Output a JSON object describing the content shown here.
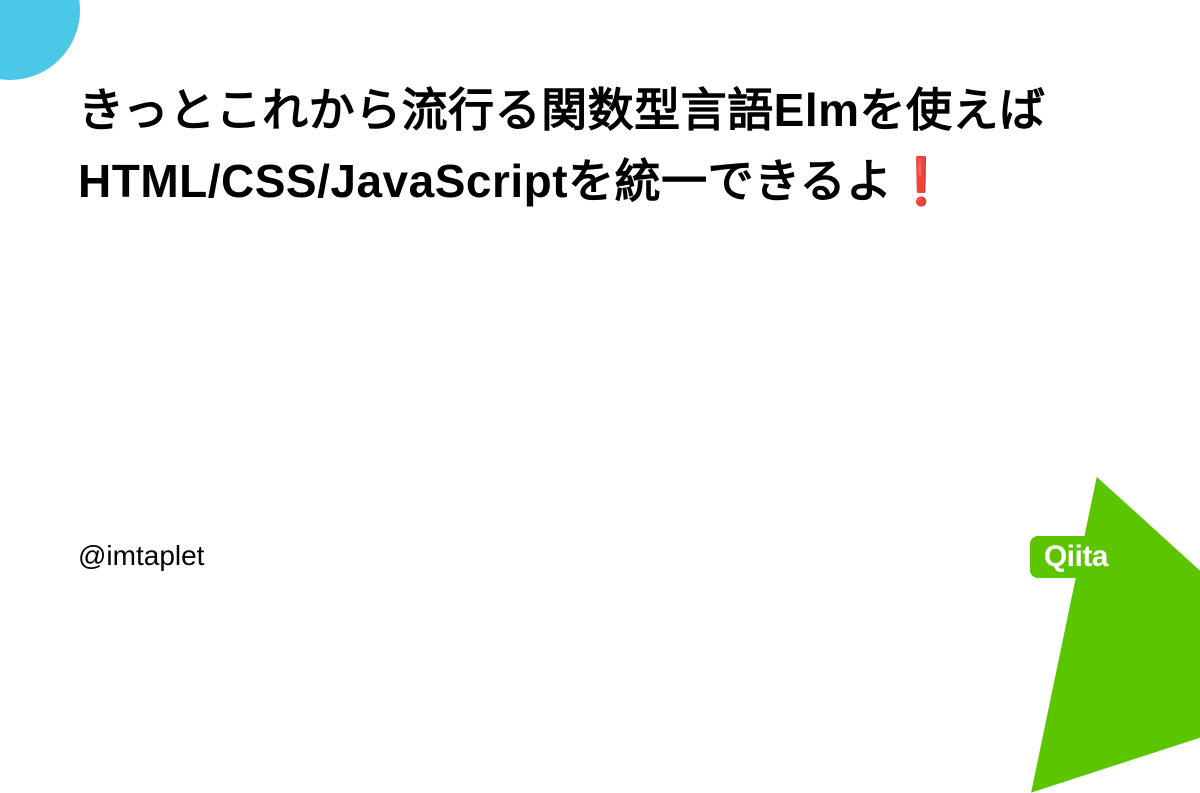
{
  "title_main": "きっとこれから流行る関数型言語Elmを使えばHTML/CSS/JavaScriptを統一できるよ",
  "title_exclamation": "❗",
  "author": "@imtaplet",
  "logo": "Qiita",
  "colors": {
    "accent_blue": "#4BC8E8",
    "accent_green": "#5BC500",
    "exclamation_red": "#E8002E"
  }
}
